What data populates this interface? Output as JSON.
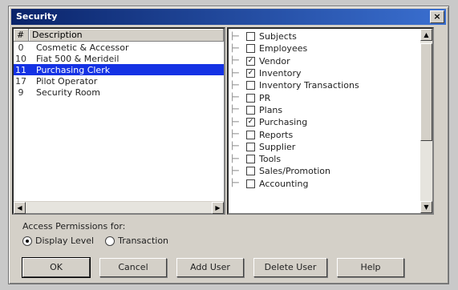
{
  "window": {
    "title": "Security",
    "close_glyph": "×"
  },
  "users_list": {
    "headers": [
      "#",
      "Description"
    ],
    "rows": [
      {
        "id": "0",
        "name": "Cosmetic & Accessor",
        "selected": false
      },
      {
        "id": "10",
        "name": "Fiat 500 & Merideil",
        "selected": false
      },
      {
        "id": "11",
        "name": "Purchasing Clerk",
        "selected": true
      },
      {
        "id": "17",
        "name": "Pilot Operator",
        "selected": false
      },
      {
        "id": "9",
        "name": "Security Room",
        "selected": false
      }
    ]
  },
  "permissions": {
    "items": [
      {
        "label": "Subjects",
        "checked": false
      },
      {
        "label": "Employees",
        "checked": false
      },
      {
        "label": "Vendor",
        "checked": true
      },
      {
        "label": "Inventory",
        "checked": true
      },
      {
        "label": "Inventory Transactions",
        "checked": false
      },
      {
        "label": "PR",
        "checked": false
      },
      {
        "label": "Plans",
        "checked": false
      },
      {
        "label": "Purchasing",
        "checked": true
      },
      {
        "label": "Reports",
        "checked": false
      },
      {
        "label": "Supplier",
        "checked": false
      },
      {
        "label": "Tools",
        "checked": false
      },
      {
        "label": "Sales/Promotion",
        "checked": false
      },
      {
        "label": "Accounting",
        "checked": false
      }
    ]
  },
  "access": {
    "label": "Access Permissions for:",
    "options": [
      {
        "label": "Display Level",
        "selected": true
      },
      {
        "label": "Transaction",
        "selected": false
      }
    ]
  },
  "buttons": {
    "ok": "OK",
    "cancel": "Cancel",
    "add_user": "Add User",
    "delete_user": "Delete User",
    "help": "Help"
  }
}
